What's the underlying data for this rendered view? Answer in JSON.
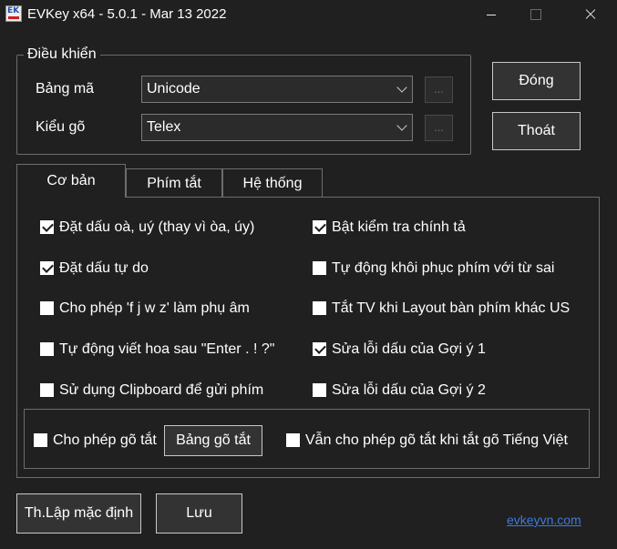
{
  "window": {
    "title": "EVKey x64 - 5.0.1 - Mar 13 2022",
    "icon": "evkey-app-icon",
    "icon_letters": "EK"
  },
  "controls": {
    "legend": "Điều khiển",
    "charset_label": "Bảng mã",
    "charset_value": "Unicode",
    "input_method_label": "Kiểu gõ",
    "input_method_value": "Telex",
    "more_label": "..."
  },
  "buttons": {
    "close": "Đóng",
    "exit": "Thoát",
    "reset_defaults": "Th.Lập mặc định",
    "save": "Lưu",
    "shortcut_table": "Bảng gõ tắt"
  },
  "tabs": [
    {
      "label": "Cơ bản",
      "active": true
    },
    {
      "label": "Phím tắt",
      "active": false
    },
    {
      "label": "Hệ thống",
      "active": false
    }
  ],
  "options": [
    {
      "label": "Đặt dấu oà, uý (thay vì òa, úy)",
      "checked": true
    },
    {
      "label": "Bật kiểm tra chính tả",
      "checked": true
    },
    {
      "label": "Đặt dấu tự do",
      "checked": true
    },
    {
      "label": "Tự động khôi phục phím với từ sai",
      "checked": false
    },
    {
      "label": "Cho phép 'f j w z' làm phụ âm",
      "checked": false
    },
    {
      "label": "Tắt TV khi Layout bàn phím khác US",
      "checked": false
    },
    {
      "label": "Tự động viết hoa sau \"Enter . ! ?\"",
      "checked": false
    },
    {
      "label": "Sửa lỗi dấu của Gợi ý 1",
      "checked": true
    },
    {
      "label": "Sử dụng Clipboard để gửi phím",
      "checked": false
    },
    {
      "label": "Sửa lỗi dấu của Gợi ý 2",
      "checked": false
    }
  ],
  "shortcut": {
    "allow_label": "Cho phép gõ tắt",
    "allow_checked": false,
    "keep_label": "Vẫn cho phép gõ tắt khi tắt gõ Tiếng Việt",
    "keep_checked": false
  },
  "footer": {
    "link_text": "evkeyvn.com"
  },
  "colors": {
    "background": "#202020",
    "link": "#3e7ad9"
  }
}
